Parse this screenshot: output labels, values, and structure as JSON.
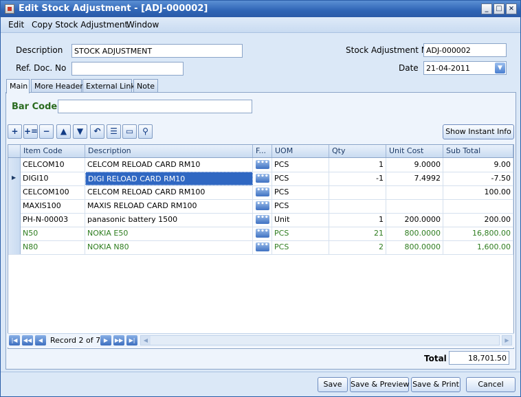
{
  "window": {
    "title": "Edit Stock Adjustment - [ADJ-000002]",
    "minimize_glyph": "_",
    "maximize_glyph": "□",
    "close_glyph": "×"
  },
  "menu": [
    "Edit",
    "Copy Stock Adjustment",
    "Window"
  ],
  "header": {
    "description_label": "Description",
    "description_value": "STOCK ADJUSTMENT",
    "refdoc_label": "Ref. Doc. No",
    "refdoc_value": "",
    "adjno_label": "Stock Adjustment No",
    "adjno_value": "ADJ-000002",
    "date_label": "Date",
    "date_value": "21-04-2011"
  },
  "tabs": [
    "Main",
    "More Header",
    "External Link",
    "Note"
  ],
  "barcode": {
    "label": "Bar Code",
    "value": ""
  },
  "toolbar": {
    "icons": [
      "add-row-icon",
      "insert-row-icon",
      "delete-row-icon",
      "move-up-icon",
      "move-down-icon",
      "undo-icon",
      "list-icon",
      "detail-icon",
      "search-icon"
    ],
    "show_instant_info": "Show Instant Info"
  },
  "grid": {
    "columns": [
      "Item Code",
      "Description",
      "F...",
      "UOM",
      "Qty",
      "Unit Cost",
      "Sub Total"
    ],
    "rows": [
      {
        "code": "CELCOM10",
        "desc": "CELCOM RELOAD CARD RM10",
        "uom": "PCS",
        "qty": "1",
        "cost": "9.0000",
        "total": "9.00",
        "color": "#000000"
      },
      {
        "code": "DIGI10",
        "desc": "DIGI RELOAD CARD RM10",
        "uom": "PCS",
        "qty": "-1",
        "cost": "7.4992",
        "total": "-7.50",
        "color": "#000000"
      },
      {
        "code": "CELCOM100",
        "desc": "CELCOM RELOAD CARD RM100",
        "uom": "PCS",
        "qty": "",
        "cost": "",
        "total": "100.00",
        "color": "#000000"
      },
      {
        "code": "MAXIS100",
        "desc": "MAXIS RELOAD CARD RM100",
        "uom": "PCS",
        "qty": "",
        "cost": "",
        "total": "",
        "color": "#000000"
      },
      {
        "code": "PH-N-00003",
        "desc": "panasonic battery 1500",
        "uom": "Unit",
        "qty": "1",
        "cost": "200.0000",
        "total": "200.00",
        "color": "#000000"
      },
      {
        "code": "N50",
        "desc": "NOKIA E50",
        "uom": "PCS",
        "qty": "21",
        "cost": "800.0000",
        "total": "16,800.00",
        "color": "#2e7d1f"
      },
      {
        "code": "N80",
        "desc": "NOKIA N80",
        "uom": "PCS",
        "qty": "2",
        "cost": "800.0000",
        "total": "1,600.00",
        "color": "#2e7d1f"
      }
    ],
    "selected_row": 1,
    "ellipsis_glyph": "•••"
  },
  "navigator": {
    "record_text": "Record 2 of 7"
  },
  "total": {
    "label": "Total",
    "value": "18,701.50"
  },
  "buttons": {
    "save": "Save",
    "save_preview": "Save & Preview",
    "save_print": "Save & Print",
    "cancel": "Cancel"
  },
  "colors": {
    "selection": "#2f67c2",
    "green_text": "#2e7d1f"
  }
}
